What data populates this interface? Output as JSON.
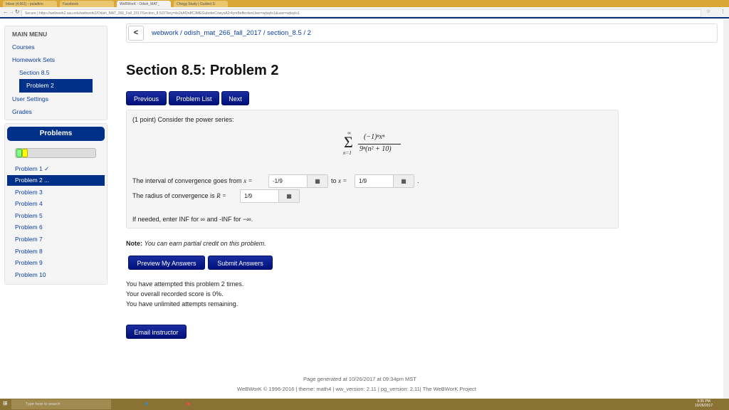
{
  "browser": {
    "tabs": [
      "Inbox (4,661) - paladino",
      "Facebook",
      "WeBWorK : Odish_MAT_",
      "Chegg Study | Guided S"
    ],
    "url": "Secure | https://webwork2.asu.edu/webwork2/Odish_MAT_266_Fall_2017/Section_8.5/2/?key=dx2kAf3rdfC3MEGubobeCowysA2r4ymBeffectiveUser=wjtaylo1&user=wjtaylo1"
  },
  "sidebar": {
    "title": "MAIN MENU",
    "items": [
      "Courses",
      "Homework Sets",
      "Section 8.5",
      "Problem 2",
      "User Settings",
      "Grades"
    ]
  },
  "problems": {
    "title": "Problems",
    "progress": {
      "correct_fraction": 0.06,
      "partial_fraction": 0.06
    },
    "items": [
      "Problem 1 ✓",
      "Problem 2 ...",
      "Problem 3",
      "Problem 4",
      "Problem 5",
      "Problem 6",
      "Problem 7",
      "Problem 8",
      "Problem 9",
      "Problem 10"
    ]
  },
  "breadcrumb": {
    "back": "<",
    "path": "webwork / odish_mat_266_fall_2017 / section_8.5 / 2"
  },
  "title": "Section 8.5: Problem 2",
  "nav": {
    "previous": "Previous",
    "list": "Problem List",
    "next": "Next"
  },
  "problem": {
    "intro": "(1 point) Consider the power series:",
    "sum_top": "∞",
    "sum_bottom": "n=1",
    "numerator": "(−1)ⁿxⁿ",
    "denominator": "9ⁿ(n² + 10)",
    "interval_label": "The interval of convergence goes from",
    "x_eq": "x =",
    "from": "-1/9",
    "to_label": "to",
    "to": "1/9",
    "radius_label": "The radius of convergence is",
    "r_eq": "R =",
    "radius": "1/9",
    "hint": "If needed, enter INF for ∞ and -INF for −∞."
  },
  "note_label": "Note:",
  "note": "You can earn partial credit on this problem.",
  "actions": {
    "preview": "Preview My Answers",
    "submit": "Submit Answers",
    "email": "Email instructor"
  },
  "status": [
    "You have attempted this problem 2 times.",
    "Your overall recorded score is 0%.",
    "You have unlimited attempts remaining."
  ],
  "footer": {
    "generated": "Page generated at 10/26/2017 at 09:34pm MST",
    "credits": "WeBWorK © 1996-2016 | theme: math4 | ww_version: 2.11 | pg_version: 2.11| The WeBWorK Project"
  },
  "taskbar": {
    "search": "Type here to search",
    "time": "9:35 PM",
    "date": "10/26/2017"
  }
}
